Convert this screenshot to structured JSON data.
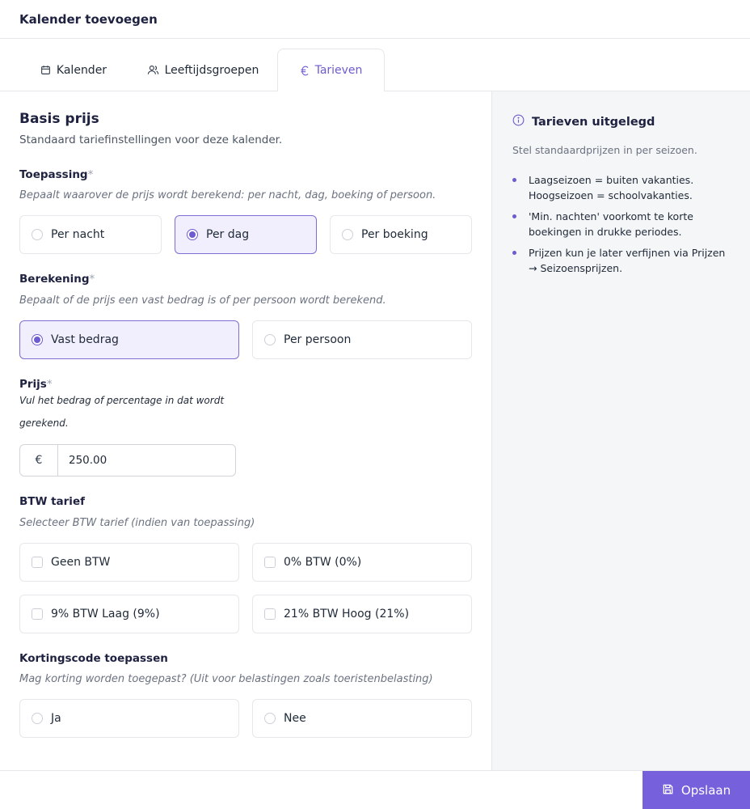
{
  "modal": {
    "title": "Kalender toevoegen"
  },
  "tabs": [
    {
      "label": "Kalender",
      "icon": "calendar-icon",
      "active": false
    },
    {
      "label": "Leeftijdsgroepen",
      "icon": "users-icon",
      "active": false
    },
    {
      "label": "Tarieven",
      "icon": "euro-icon",
      "active": true
    }
  ],
  "section": {
    "title": "Basis prijs",
    "subtitle": "Standaard tariefinstellingen voor deze kalender."
  },
  "toepassing": {
    "label": "Toepassing",
    "required": "*",
    "hint": "Bepaalt waarover de prijs wordt berekend: per nacht, dag, boeking of persoon.",
    "options": [
      "Per nacht",
      "Per dag",
      "Per boeking"
    ],
    "selected": "Per dag"
  },
  "berekening": {
    "label": "Berekening",
    "required": "*",
    "hint": "Bepaalt of de prijs een vast bedrag is of per persoon wordt berekend.",
    "options": [
      "Vast bedrag",
      "Per persoon"
    ],
    "selected": "Vast bedrag"
  },
  "prijs": {
    "label": "Prijs",
    "required": "*",
    "hint_line1": "Vul het bedrag of percentage in dat wordt",
    "hint_line2": "gerekend.",
    "currency": "€",
    "value": "250.00"
  },
  "btw": {
    "label": "BTW tarief",
    "hint": "Selecteer BTW tarief (indien van toepassing)",
    "options": [
      "Geen BTW",
      "0% BTW (0%)",
      "9% BTW Laag (9%)",
      "21% BTW Hoog (21%)"
    ]
  },
  "korting": {
    "label": "Kortingscode toepassen",
    "hint": "Mag korting worden toegepast? (Uit voor belastingen zoals toeristenbelasting)",
    "options": [
      "Ja",
      "Nee"
    ]
  },
  "sidebar": {
    "title": "Tarieven uitgelegd",
    "intro": "Stel standaardprijzen in per seizoen.",
    "bullets": [
      "Laagseizoen = buiten vakanties. Hoogseizoen = schoolvakanties.",
      "'Min. nachten' voorkomt te korte boekingen in drukke periodes.",
      "Prijzen kun je later verfijnen via Prijzen → Seizoensprijzen."
    ]
  },
  "footer": {
    "save_label": "Opslaan"
  },
  "colors": {
    "accent": "#6d5bd0",
    "button": "#7760dc",
    "selected_bg": "#f1effd",
    "sidebar_bg": "#f5f6f8"
  }
}
